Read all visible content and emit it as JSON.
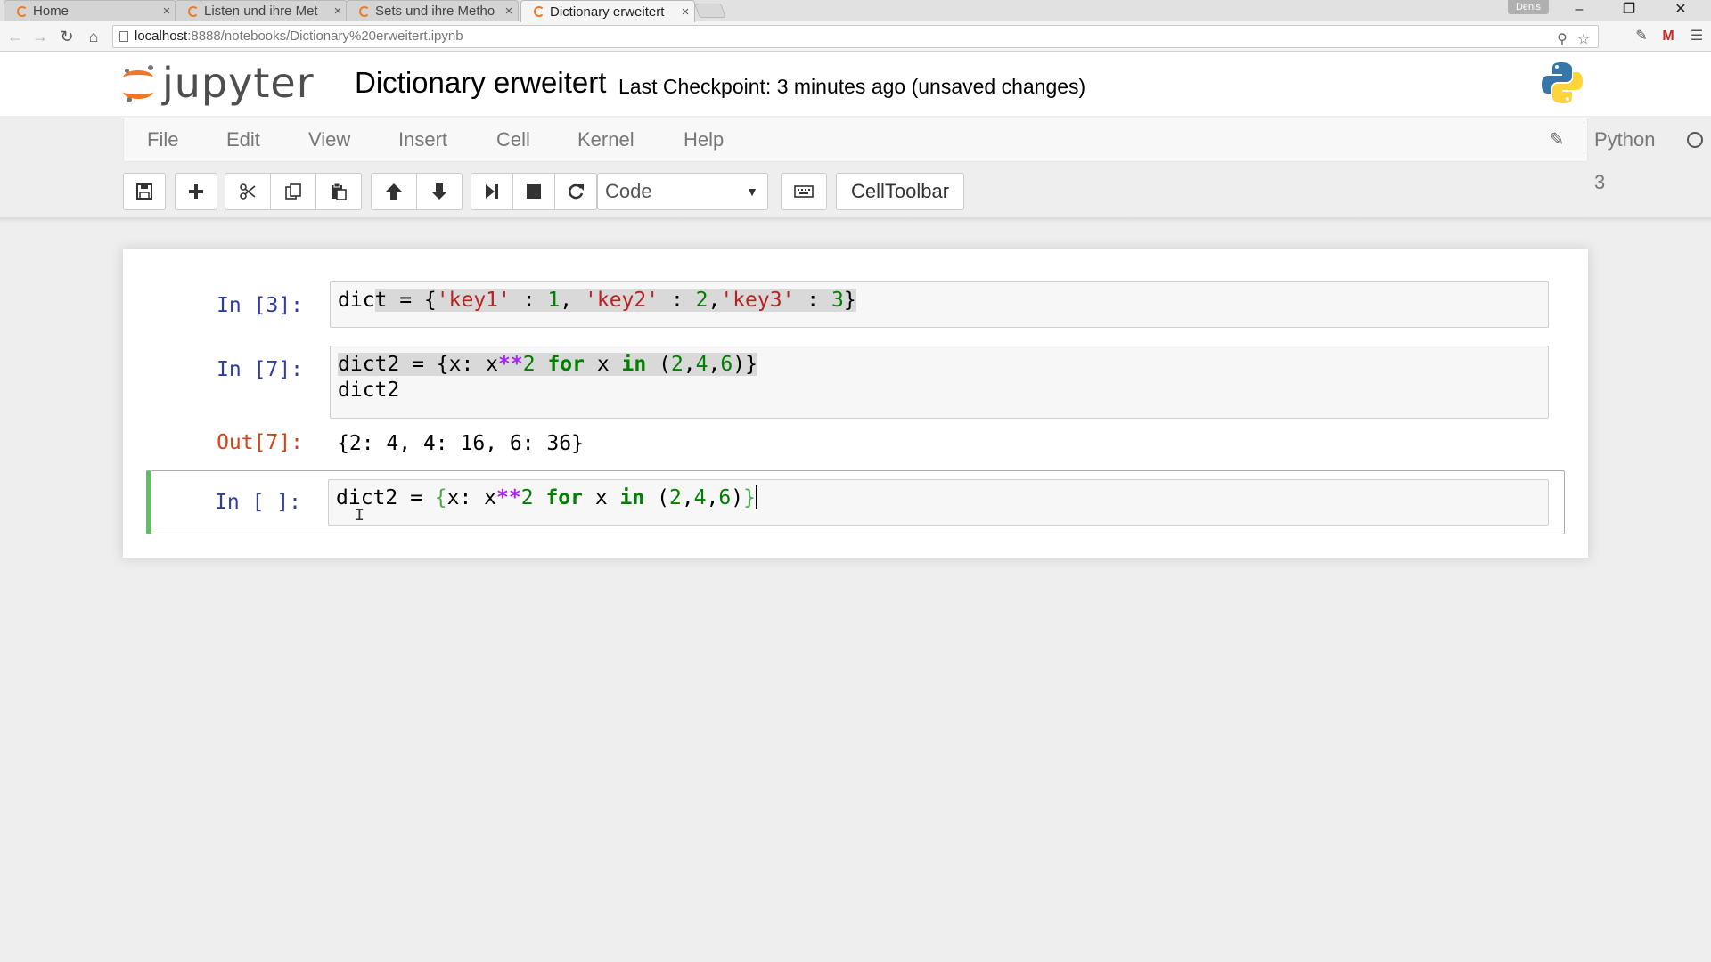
{
  "browser": {
    "tabs": [
      {
        "title": "Home",
        "active": false
      },
      {
        "title": "Listen und ihre Met",
        "active": false
      },
      {
        "title": "Sets und ihre Metho",
        "active": false
      },
      {
        "title": "Dictionary erweitert",
        "active": true
      }
    ],
    "tab_close": "×",
    "user_badge": "Denis",
    "url_host": "localhost",
    "url_path": ":8888/notebooks/Dictionary%20erweitert.ipynb"
  },
  "header": {
    "logo_text": "jupyter",
    "notebook_name": "Dictionary erweitert",
    "checkpoint": "Last Checkpoint: 3 minutes ago (unsaved changes)"
  },
  "menubar": {
    "items": [
      "File",
      "Edit",
      "View",
      "Insert",
      "Cell",
      "Kernel",
      "Help"
    ],
    "kernel_name": "Python 3"
  },
  "toolbar": {
    "cell_type": "Code",
    "celltoolbar_label": "CellToolbar"
  },
  "cells": {
    "c1": {
      "prompt": "In [3]:",
      "t1": "dic",
      "t2": "t = {",
      "s1": "'key1'",
      "t3": " : ",
      "n1": "1",
      "t4": ", ",
      "s2": "'key2'",
      "t5": " : ",
      "n2": "2",
      "t6": ",",
      "s3": "'key3'",
      "t7": " : ",
      "n3": "3",
      "t8": "}"
    },
    "c2": {
      "prompt": "In [7]:",
      "a1": "dict2 = {x: x",
      "op": "**",
      "n1": "2",
      "sp1": " ",
      "kw1": "for",
      "a2": " x ",
      "kw2": "in",
      "a3": " (",
      "n2": "2",
      "a4": ",",
      "n3": "4",
      "a5": ",",
      "n4": "6",
      "a6": ")}",
      "line2": "dict2",
      "out_prompt": "Out[7]:",
      "output": "{2: 4, 4: 16, 6: 36}"
    },
    "c3": {
      "prompt": "In [ ]:",
      "a1": "dict2 = ",
      "b1": "{",
      "a2": "x: x",
      "op": "**",
      "n1": "2",
      "sp1": " ",
      "kw1": "for",
      "a3": " x ",
      "kw2": "in",
      "a4": " (",
      "n2": "2",
      "a5": ",",
      "n3": "4",
      "a6": ",",
      "n4": "6",
      "a7": ")",
      "b2": "}"
    }
  }
}
